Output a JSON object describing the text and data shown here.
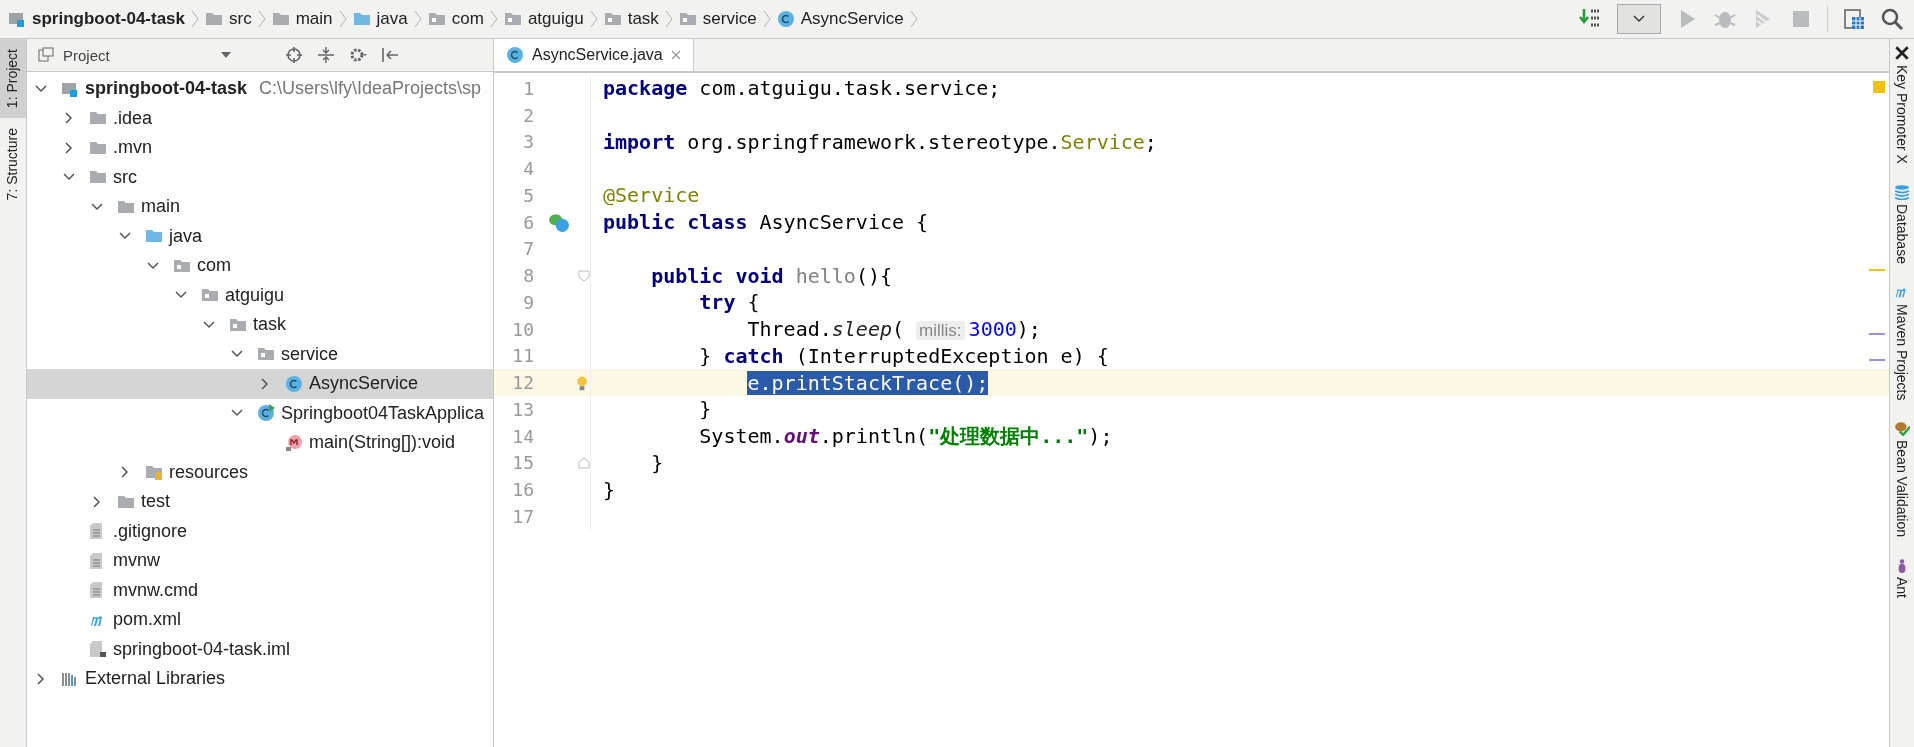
{
  "breadcrumbs": [
    {
      "label": "springboot-04-task",
      "kind": "module"
    },
    {
      "label": "src",
      "kind": "folder"
    },
    {
      "label": "main",
      "kind": "folder"
    },
    {
      "label": "java",
      "kind": "source"
    },
    {
      "label": "com",
      "kind": "package"
    },
    {
      "label": "atguigu",
      "kind": "package"
    },
    {
      "label": "task",
      "kind": "package"
    },
    {
      "label": "service",
      "kind": "package"
    },
    {
      "label": "AsyncService",
      "kind": "class"
    }
  ],
  "left_strip": [
    {
      "label": "1: Project",
      "selected": true
    },
    {
      "label": "7: Structure",
      "selected": false
    }
  ],
  "project_panel": {
    "title": "Project",
    "tree": [
      {
        "label": "springboot-04-task",
        "path": "C:\\Users\\lfy\\IdeaProjects\\sp",
        "kind": "module",
        "expanded": true,
        "selected": false,
        "children": [
          {
            "label": ".idea",
            "kind": "folder",
            "expanded": false,
            "selected": false
          },
          {
            "label": ".mvn",
            "kind": "folder",
            "expanded": false,
            "selected": false
          },
          {
            "label": "src",
            "kind": "folder",
            "expanded": true,
            "selected": false,
            "children": [
              {
                "label": "main",
                "kind": "folder",
                "expanded": true,
                "selected": false,
                "children": [
                  {
                    "label": "java",
                    "kind": "source",
                    "expanded": true,
                    "selected": false,
                    "children": [
                      {
                        "label": "com",
                        "kind": "package",
                        "expanded": true,
                        "selected": false,
                        "children": [
                          {
                            "label": "atguigu",
                            "kind": "package",
                            "expanded": true,
                            "selected": false,
                            "children": [
                              {
                                "label": "task",
                                "kind": "package",
                                "expanded": true,
                                "selected": false,
                                "children": [
                                  {
                                    "label": "service",
                                    "kind": "package",
                                    "expanded": true,
                                    "selected": false,
                                    "children": [
                                      {
                                        "label": "AsyncService",
                                        "kind": "class",
                                        "expanded": false,
                                        "selected": true
                                      }
                                    ]
                                  },
                                  {
                                    "label": "Springboot04TaskApplica",
                                    "kind": "app",
                                    "expanded": true,
                                    "selected": false,
                                    "children": [
                                      {
                                        "label": "main(String[]):void",
                                        "kind": "method",
                                        "selected": false
                                      }
                                    ]
                                  }
                                ]
                              }
                            ]
                          }
                        ]
                      }
                    ]
                  },
                  {
                    "label": "resources",
                    "kind": "resources",
                    "expanded": false,
                    "selected": false
                  }
                ]
              },
              {
                "label": "test",
                "kind": "folder",
                "expanded": false,
                "selected": false
              }
            ]
          },
          {
            "label": ".gitignore",
            "kind": "file",
            "selected": false
          },
          {
            "label": "mvnw",
            "kind": "file",
            "selected": false
          },
          {
            "label": "mvnw.cmd",
            "kind": "file",
            "selected": false
          },
          {
            "label": "pom.xml",
            "kind": "maven",
            "selected": false
          },
          {
            "label": "springboot-04-task.iml",
            "kind": "iml",
            "selected": false
          }
        ]
      },
      {
        "label": "External Libraries",
        "kind": "libraries",
        "expanded": false,
        "selected": false
      }
    ]
  },
  "editor": {
    "tabs": [
      {
        "label": "AsyncService.java",
        "selected": true
      }
    ],
    "lines": [
      {
        "number": "1",
        "current": false,
        "tokens": [
          {
            "kind": "keyword",
            "text": "package"
          },
          {
            "kind": "plain",
            "text": " com.atguigu.task.service;"
          }
        ]
      },
      {
        "number": "2",
        "current": false
      },
      {
        "number": "3",
        "current": false,
        "tokens": [
          {
            "kind": "keyword",
            "text": "import"
          },
          {
            "kind": "plain",
            "text": " org.springframework.stereotype."
          },
          {
            "kind": "annotation",
            "text": "Service"
          },
          {
            "kind": "plain",
            "text": ";"
          }
        ]
      },
      {
        "number": "4",
        "current": false
      },
      {
        "number": "5",
        "current": false,
        "tokens": [
          {
            "kind": "annotation",
            "text": "@Service"
          }
        ]
      },
      {
        "number": "6",
        "current": false,
        "marker": {
          "kind": "bean"
        },
        "tokens": [
          {
            "kind": "keyword",
            "text": "public class"
          },
          {
            "kind": "plain",
            "text": " AsyncService {"
          }
        ],
        "children": [
          {
            "number": "7",
            "current": false
          },
          {
            "number": "8",
            "current": false,
            "fold": {
              "kind": "start"
            },
            "tokens": [
              {
                "kind": "keyword",
                "text": "public void "
              },
              {
                "kind": "unused",
                "text": "hello"
              },
              {
                "kind": "plain",
                "text": "(){"
              }
            ],
            "children": [
              {
                "number": "9",
                "current": false,
                "tokens": [
                  {
                    "kind": "keyword",
                    "text": "try"
                  },
                  {
                    "kind": "plain",
                    "text": " {"
                  }
                ],
                "children": [
                  {
                    "number": "10",
                    "current": false,
                    "tokens": [
                      {
                        "kind": "plain",
                        "text": "Thread."
                      },
                      {
                        "kind": "static",
                        "text": "sleep"
                      },
                      {
                        "kind": "plain",
                        "text": "( "
                      },
                      {
                        "kind": "hint",
                        "text": "millis:"
                      },
                      {
                        "kind": "number",
                        "text": "3000"
                      },
                      {
                        "kind": "plain",
                        "text": ");"
                      }
                    ]
                  }
                ]
              },
              {
                "number": "11",
                "current": false,
                "tokens": [
                  {
                    "kind": "plain",
                    "text": "} "
                  },
                  {
                    "kind": "keyword",
                    "text": "catch"
                  },
                  {
                    "kind": "plain",
                    "text": " (InterruptedException e) {"
                  }
                ],
                "children": [
                  {
                    "number": "12",
                    "current": true,
                    "marker": {
                      "kind": "bulb"
                    },
                    "tokens": [
                      {
                        "kind": "selected",
                        "text": "e.printStackTrace();"
                      }
                    ]
                  }
                ]
              },
              {
                "number": "13",
                "current": false,
                "tokens": [
                  {
                    "kind": "plain",
                    "text": "}"
                  }
                ]
              },
              {
                "number": "14",
                "current": false,
                "tokens": [
                  {
                    "kind": "plain",
                    "text": "System."
                  },
                  {
                    "kind": "static_field",
                    "text": "out"
                  },
                  {
                    "kind": "plain",
                    "text": ".println("
                  },
                  {
                    "kind": "string",
                    "text": "\"处理数据中...\""
                  },
                  {
                    "kind": "plain",
                    "text": ");"
                  }
                ]
              }
            ]
          },
          {
            "number": "15",
            "current": false,
            "fold": {
              "kind": "end"
            },
            "tokens": [
              {
                "kind": "plain",
                "text": "}"
              }
            ]
          }
        ]
      },
      {
        "number": "16",
        "current": false,
        "tokens": [
          {
            "kind": "plain",
            "text": "}"
          }
        ]
      },
      {
        "number": "17",
        "current": false
      }
    ]
  },
  "right_strip": [
    {
      "label": "Key Promoter X",
      "kind": "close"
    },
    {
      "label": "Database",
      "kind": "database"
    },
    {
      "label": "Maven Projects",
      "kind": "maven"
    },
    {
      "label": "Bean Validation",
      "kind": "bean"
    },
    {
      "label": "Ant",
      "kind": "ant"
    }
  ]
}
